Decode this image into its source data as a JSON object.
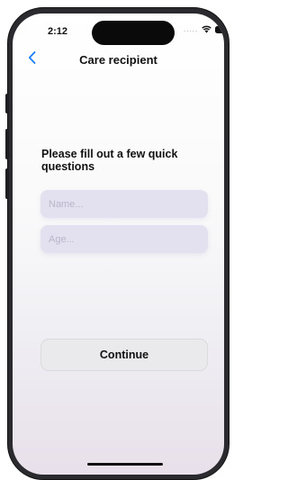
{
  "status_bar": {
    "time": "2:12",
    "signal": "....."
  },
  "nav": {
    "title": "Care recipient",
    "back_icon": "chevron-left-icon"
  },
  "form": {
    "prompt": "Please fill out a few quick questions",
    "name_placeholder": "Name...",
    "age_placeholder": "Age...",
    "continue_label": "Continue"
  },
  "colors": {
    "accent": "#1a7cf5",
    "field_background": "#e3e1ef",
    "button_background": "#eaeaec"
  }
}
